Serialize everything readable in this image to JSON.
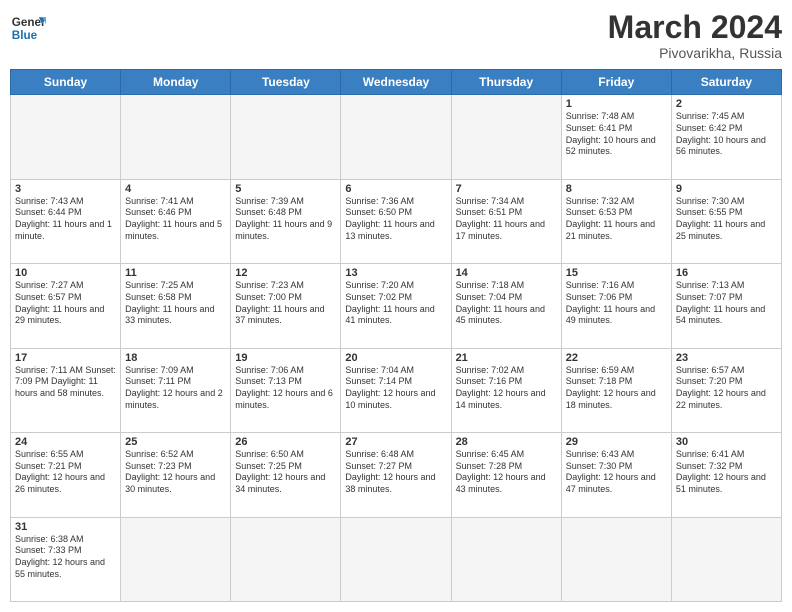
{
  "header": {
    "logo_general": "General",
    "logo_blue": "Blue",
    "title": "March 2024",
    "subtitle": "Pivovarikha, Russia"
  },
  "days_of_week": [
    "Sunday",
    "Monday",
    "Tuesday",
    "Wednesday",
    "Thursday",
    "Friday",
    "Saturday"
  ],
  "weeks": [
    [
      {
        "day": "",
        "info": ""
      },
      {
        "day": "",
        "info": ""
      },
      {
        "day": "",
        "info": ""
      },
      {
        "day": "",
        "info": ""
      },
      {
        "day": "",
        "info": ""
      },
      {
        "day": "1",
        "info": "Sunrise: 7:48 AM\nSunset: 6:41 PM\nDaylight: 10 hours and 52 minutes."
      },
      {
        "day": "2",
        "info": "Sunrise: 7:45 AM\nSunset: 6:42 PM\nDaylight: 10 hours and 56 minutes."
      }
    ],
    [
      {
        "day": "3",
        "info": "Sunrise: 7:43 AM\nSunset: 6:44 PM\nDaylight: 11 hours and 1 minute."
      },
      {
        "day": "4",
        "info": "Sunrise: 7:41 AM\nSunset: 6:46 PM\nDaylight: 11 hours and 5 minutes."
      },
      {
        "day": "5",
        "info": "Sunrise: 7:39 AM\nSunset: 6:48 PM\nDaylight: 11 hours and 9 minutes."
      },
      {
        "day": "6",
        "info": "Sunrise: 7:36 AM\nSunset: 6:50 PM\nDaylight: 11 hours and 13 minutes."
      },
      {
        "day": "7",
        "info": "Sunrise: 7:34 AM\nSunset: 6:51 PM\nDaylight: 11 hours and 17 minutes."
      },
      {
        "day": "8",
        "info": "Sunrise: 7:32 AM\nSunset: 6:53 PM\nDaylight: 11 hours and 21 minutes."
      },
      {
        "day": "9",
        "info": "Sunrise: 7:30 AM\nSunset: 6:55 PM\nDaylight: 11 hours and 25 minutes."
      }
    ],
    [
      {
        "day": "10",
        "info": "Sunrise: 7:27 AM\nSunset: 6:57 PM\nDaylight: 11 hours and 29 minutes."
      },
      {
        "day": "11",
        "info": "Sunrise: 7:25 AM\nSunset: 6:58 PM\nDaylight: 11 hours and 33 minutes."
      },
      {
        "day": "12",
        "info": "Sunrise: 7:23 AM\nSunset: 7:00 PM\nDaylight: 11 hours and 37 minutes."
      },
      {
        "day": "13",
        "info": "Sunrise: 7:20 AM\nSunset: 7:02 PM\nDaylight: 11 hours and 41 minutes."
      },
      {
        "day": "14",
        "info": "Sunrise: 7:18 AM\nSunset: 7:04 PM\nDaylight: 11 hours and 45 minutes."
      },
      {
        "day": "15",
        "info": "Sunrise: 7:16 AM\nSunset: 7:06 PM\nDaylight: 11 hours and 49 minutes."
      },
      {
        "day": "16",
        "info": "Sunrise: 7:13 AM\nSunset: 7:07 PM\nDaylight: 11 hours and 54 minutes."
      }
    ],
    [
      {
        "day": "17",
        "info": "Sunrise: 7:11 AM\nSunset: 7:09 PM\nDaylight: 11 hours and 58 minutes."
      },
      {
        "day": "18",
        "info": "Sunrise: 7:09 AM\nSunset: 7:11 PM\nDaylight: 12 hours and 2 minutes."
      },
      {
        "day": "19",
        "info": "Sunrise: 7:06 AM\nSunset: 7:13 PM\nDaylight: 12 hours and 6 minutes."
      },
      {
        "day": "20",
        "info": "Sunrise: 7:04 AM\nSunset: 7:14 PM\nDaylight: 12 hours and 10 minutes."
      },
      {
        "day": "21",
        "info": "Sunrise: 7:02 AM\nSunset: 7:16 PM\nDaylight: 12 hours and 14 minutes."
      },
      {
        "day": "22",
        "info": "Sunrise: 6:59 AM\nSunset: 7:18 PM\nDaylight: 12 hours and 18 minutes."
      },
      {
        "day": "23",
        "info": "Sunrise: 6:57 AM\nSunset: 7:20 PM\nDaylight: 12 hours and 22 minutes."
      }
    ],
    [
      {
        "day": "24",
        "info": "Sunrise: 6:55 AM\nSunset: 7:21 PM\nDaylight: 12 hours and 26 minutes."
      },
      {
        "day": "25",
        "info": "Sunrise: 6:52 AM\nSunset: 7:23 PM\nDaylight: 12 hours and 30 minutes."
      },
      {
        "day": "26",
        "info": "Sunrise: 6:50 AM\nSunset: 7:25 PM\nDaylight: 12 hours and 34 minutes."
      },
      {
        "day": "27",
        "info": "Sunrise: 6:48 AM\nSunset: 7:27 PM\nDaylight: 12 hours and 38 minutes."
      },
      {
        "day": "28",
        "info": "Sunrise: 6:45 AM\nSunset: 7:28 PM\nDaylight: 12 hours and 43 minutes."
      },
      {
        "day": "29",
        "info": "Sunrise: 6:43 AM\nSunset: 7:30 PM\nDaylight: 12 hours and 47 minutes."
      },
      {
        "day": "30",
        "info": "Sunrise: 6:41 AM\nSunset: 7:32 PM\nDaylight: 12 hours and 51 minutes."
      }
    ],
    [
      {
        "day": "31",
        "info": "Sunrise: 6:38 AM\nSunset: 7:33 PM\nDaylight: 12 hours and 55 minutes."
      },
      {
        "day": "",
        "info": ""
      },
      {
        "day": "",
        "info": ""
      },
      {
        "day": "",
        "info": ""
      },
      {
        "day": "",
        "info": ""
      },
      {
        "day": "",
        "info": ""
      },
      {
        "day": "",
        "info": ""
      }
    ]
  ]
}
